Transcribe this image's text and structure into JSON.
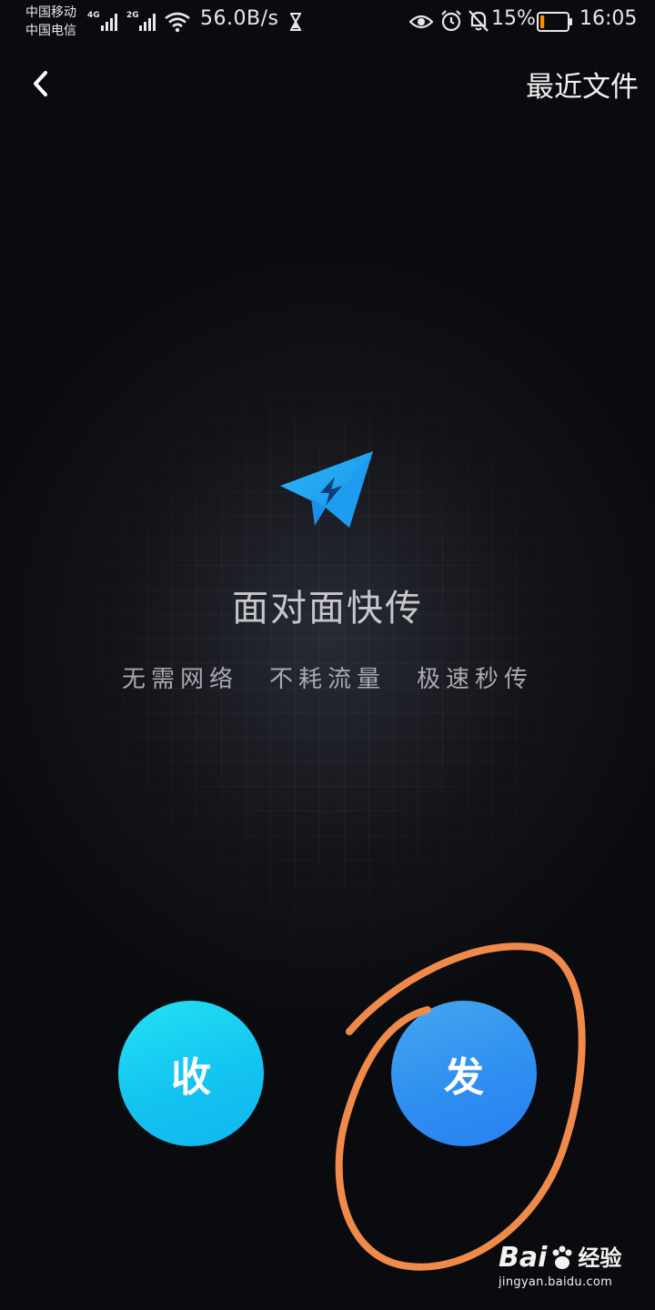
{
  "status_bar": {
    "carrier_1": "中国移动",
    "carrier_2": "中国电信",
    "net_1": "4G",
    "net_2": "2G",
    "speed": "56.0B/s",
    "battery_percent": "15%",
    "battery_level": 0.15,
    "time": "16:05",
    "icons": [
      "signal-icon",
      "wifi-icon",
      "hourglass-icon",
      "eye-icon",
      "alarm-icon",
      "bell-off-icon",
      "battery-icon"
    ]
  },
  "header": {
    "back_icon": "chevron-left-icon",
    "recent_files_label": "最近文件"
  },
  "main": {
    "logo_icon": "paper-plane-icon",
    "title": "面对面快传",
    "features": [
      "无需网络",
      "不耗流量",
      "极速秒传"
    ]
  },
  "actions": {
    "receive_label": "收",
    "send_label": "发"
  },
  "watermark": {
    "brand_left": "Bai",
    "brand_right": "经验",
    "url": "jingyan.baidu.com"
  },
  "colors": {
    "receive": "#14c4f0",
    "send": "#2f8ff0",
    "plane": "#1aa3f0",
    "annotation": "#f08a4b",
    "battery": "#ff8a00"
  }
}
